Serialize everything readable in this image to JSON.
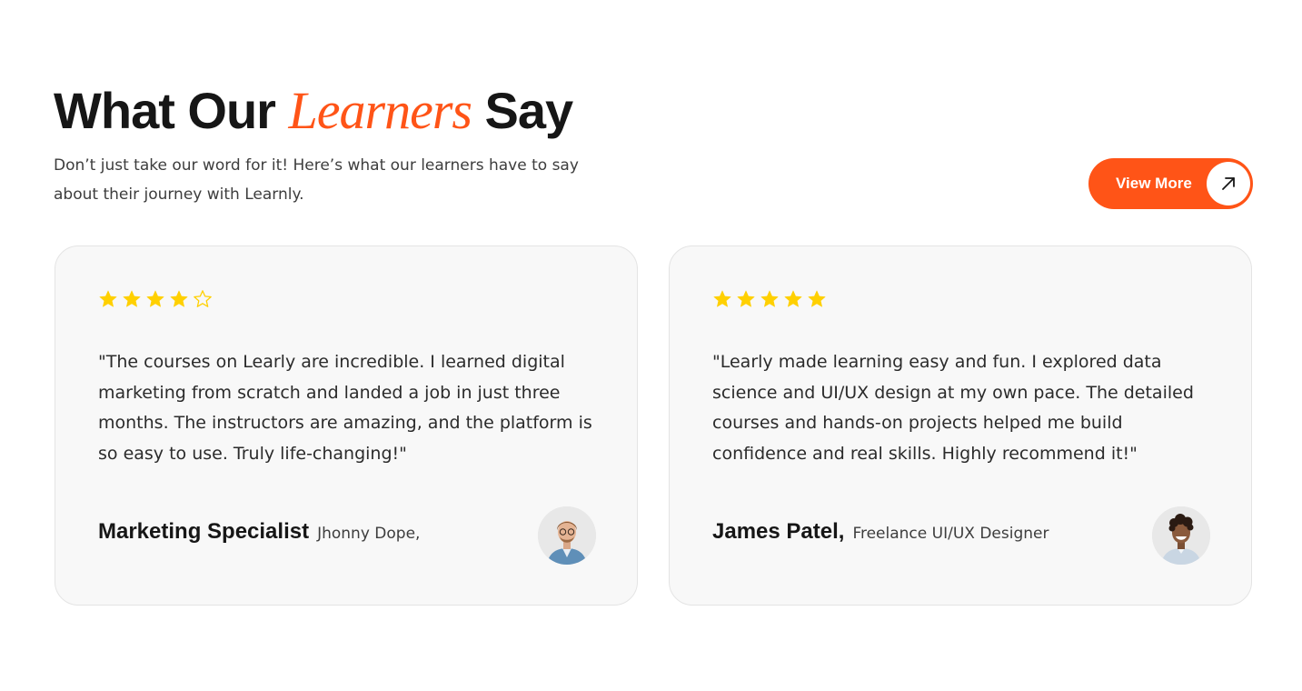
{
  "section": {
    "heading_part1": "What Our ",
    "heading_accent": "Learners",
    "heading_part2": " Say",
    "subtitle": "Don’t just take our word for it! Here’s what our learners have to say about their journey with Learnly.",
    "view_more_label": "View More",
    "view_more_icon": "arrow-up-right-icon"
  },
  "colors": {
    "accent": "#ff5417",
    "star": "#ffd000",
    "card_bg": "#f8f8f8",
    "text_dark": "#161616"
  },
  "testimonials": [
    {
      "rating": 4,
      "max_rating": 5,
      "quote": "\"The courses on Learly are incredible. I learned digital marketing from scratch and landed a job in just three months. The instructors are amazing, and the platform is so easy to use. Truly life-changing!\"",
      "name": "Marketing Specialist",
      "role": "Jhonny Dope,",
      "avatar_icon": "person-avatar"
    },
    {
      "rating": 5,
      "max_rating": 5,
      "quote": "\"Learly made learning easy and fun. I explored data science and UI/UX design at my own pace. The detailed courses and hands-on projects helped me build confidence and real skills. Highly recommend it!\"",
      "name": "James Patel,",
      "role": "Freelance UI/UX Designer",
      "avatar_icon": "person-avatar"
    }
  ]
}
